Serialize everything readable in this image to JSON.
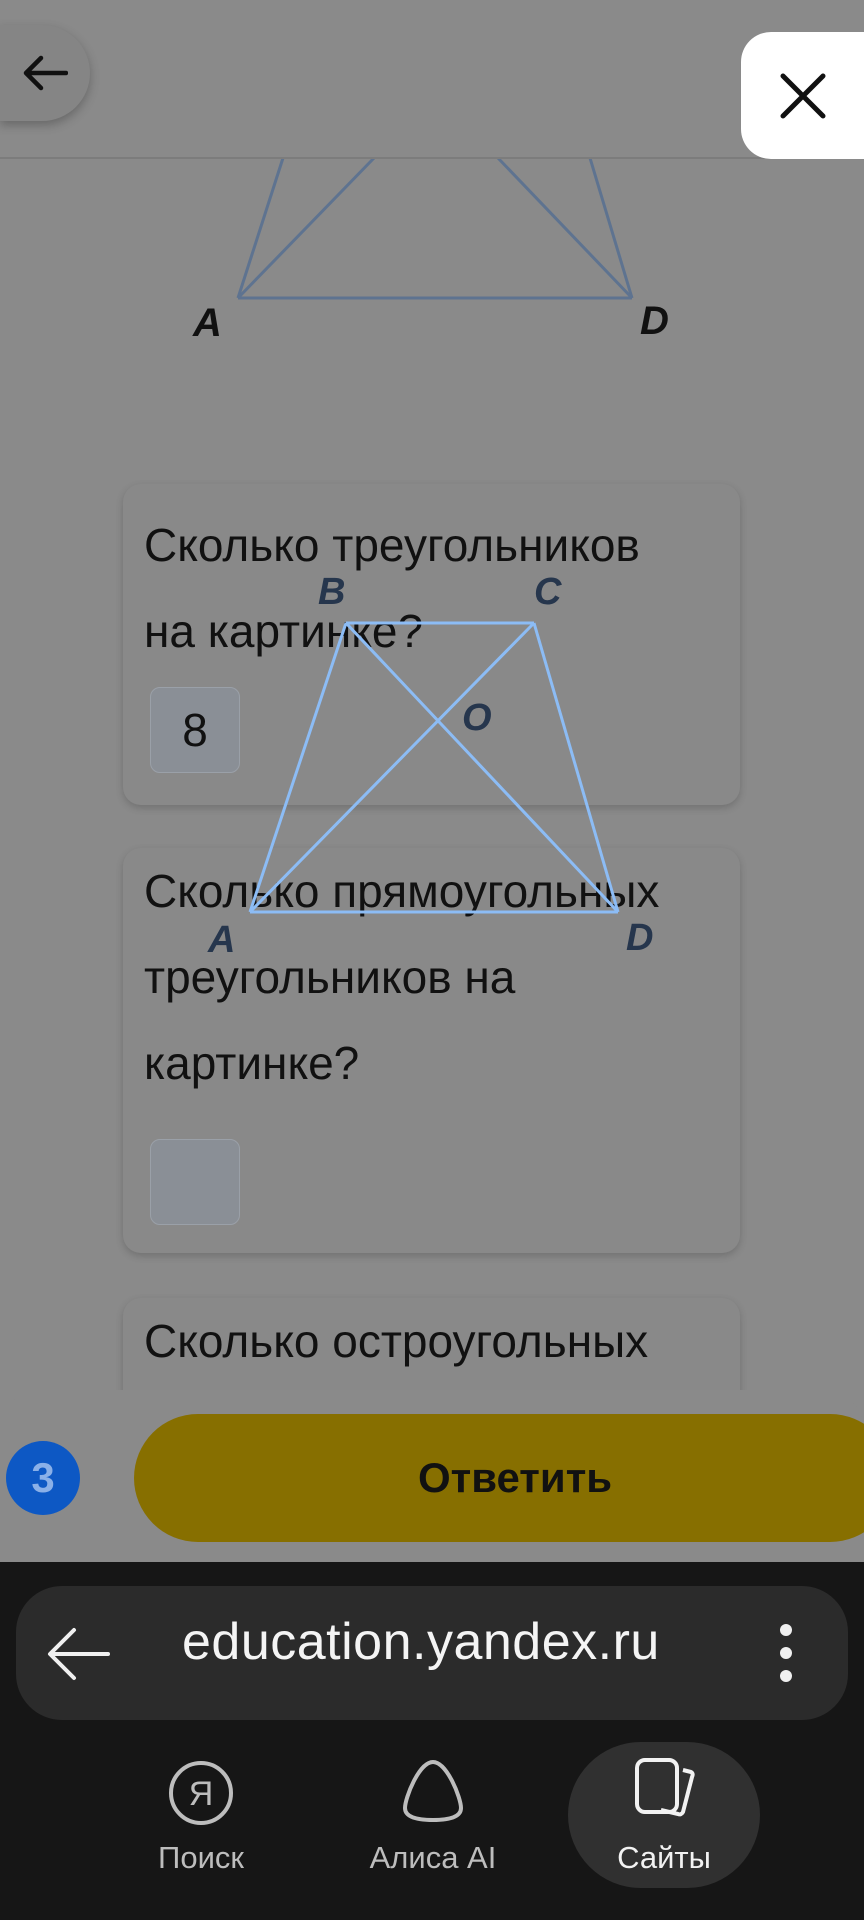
{
  "diagram_top": {
    "labels": {
      "a": "A",
      "d": "D"
    }
  },
  "overlay_diagram": {
    "labels": {
      "a": "A",
      "b": "B",
      "c": "C",
      "d": "D",
      "o": "O"
    }
  },
  "questions": [
    {
      "text_line1": "Сколько треугольников",
      "text_line2": "на картинке?",
      "answer": "8"
    },
    {
      "text_line1": "Сколько прямоугольных",
      "text_line2": "треугольников на",
      "text_line3": "картинке?",
      "answer": ""
    },
    {
      "text_line1": "Сколько остроугольных"
    }
  ],
  "footer": {
    "counter": "3",
    "submit_label": "Ответить"
  },
  "browser": {
    "url": "education.yandex.ru",
    "nav": [
      {
        "label": "Поиск",
        "icon": "yandex-search-icon"
      },
      {
        "label": "Алиса AI",
        "icon": "alice-icon"
      },
      {
        "label": "Сайты",
        "icon": "sites-icon"
      }
    ]
  },
  "colors": {
    "accent_yellow": "#876f00",
    "badge_blue": "#0d58c4",
    "overlay_lines": "#8cbcf5"
  }
}
